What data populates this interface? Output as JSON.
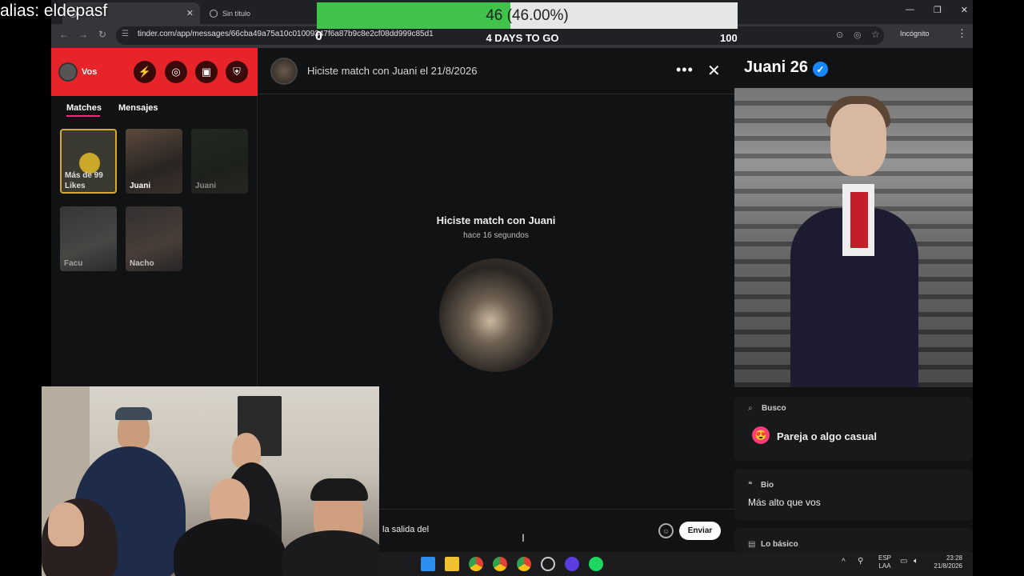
{
  "overlay": {
    "alias": "alias: eldepasf",
    "goal_text": "46 (46.00%)",
    "goal_progress": 0.46,
    "goal_min": "0",
    "goal_days": "4 DAYS TO GO",
    "goal_max": "100"
  },
  "browser": {
    "tab_active": "",
    "tab_inactive": "Sin título",
    "url": "tinder.com/app/messages/66cba49a75a10c01009347f6a87b9c8e2cf08dd999c85d1",
    "incognito_label": "Incógnito"
  },
  "sidebar": {
    "user_label": "Vos",
    "tabs": [
      "Matches",
      "Mensajes"
    ],
    "likes_card_text": "Más de 99 Likes",
    "matches": [
      {
        "name": "Juani"
      },
      {
        "name": "Juani"
      },
      {
        "name": "Facu"
      },
      {
        "name": "Nacho"
      }
    ]
  },
  "chat": {
    "header_title": "Hiciste match con Juani el 21/8/2026",
    "match_title": "Hiciste match con Juani",
    "match_time": "hace 16 segundos",
    "draft_text": "la salida del",
    "send_label": "Enviar"
  },
  "profile": {
    "name_age": "Juani 26",
    "busco_label": "Busco",
    "busco_value": "Pareja o algo casual",
    "bio_label": "Bio",
    "bio_value": "Más alto que vos",
    "basico_label": "Lo básico"
  },
  "taskbar": {
    "lang": "ESP",
    "lang_sub": "LAA",
    "time": "23:28",
    "date": "21/8/2026"
  },
  "colors": {
    "tinder_red": "#e8242b",
    "accent_pink": "#fd267a",
    "verified_blue": "#1786ff",
    "goal_green": "#3fc34a"
  }
}
